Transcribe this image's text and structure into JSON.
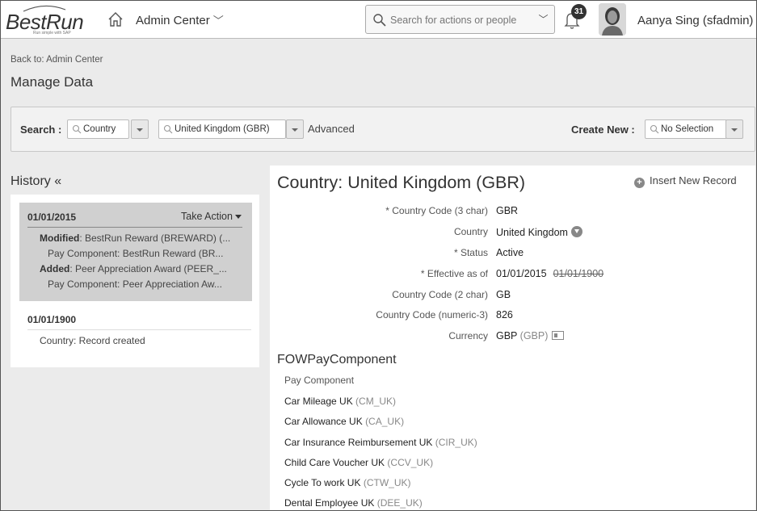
{
  "header": {
    "logo_text": "BestRun",
    "logo_tagline": "Run simple with SAP",
    "module": "Admin Center",
    "search_placeholder": "Search for actions or people",
    "notification_count": "31",
    "user": "Aanya Sing (sfadmin)"
  },
  "breadcrumb": "Back to: Admin Center",
  "page_title": "Manage Data",
  "search_bar": {
    "label": "Search :",
    "type_value": "Country",
    "record_value": "United Kingdom (GBR)",
    "advanced": "Advanced",
    "create_label": "Create New :",
    "create_value": "No Selection"
  },
  "history": {
    "title": "History «",
    "entries": [
      {
        "date": "01/01/2015",
        "action": "Take Action",
        "lines": [
          {
            "bold": "Modified",
            "text": ": BestRun Reward (BREWARD) (..."
          },
          {
            "bold": "",
            "text": "Pay Component: BestRun Reward (BR..."
          },
          {
            "bold": "Added",
            "text": ": Peer Appreciation Award (PEER_..."
          },
          {
            "bold": "",
            "text": "Pay Component: Peer Appreciation Aw..."
          }
        ]
      },
      {
        "date": "01/01/1900",
        "lines": [
          {
            "bold": "",
            "text": "Country: Record created"
          }
        ]
      }
    ]
  },
  "record": {
    "title": "Country: United Kingdom (GBR)",
    "insert_new": "Insert New Record",
    "fields": [
      {
        "label": "* Country Code (3 char)",
        "value": "GBR"
      },
      {
        "label": "Country",
        "value": "United Kingdom"
      },
      {
        "label": "* Status",
        "value": "Active"
      },
      {
        "label": "* Effective as of",
        "value": "01/01/2015",
        "old_value": "01/01/1900"
      },
      {
        "label": "Country Code (2 char)",
        "value": "GB"
      },
      {
        "label": "Country Code (numeric-3)",
        "value": "826"
      },
      {
        "label": "Currency",
        "value": "GBP",
        "sub": "(GBP)"
      }
    ],
    "section_title": "FOWPayComponent",
    "pay_head": "Pay Component",
    "pay_components": [
      {
        "name": "Car Mileage UK",
        "code": "(CM_UK)"
      },
      {
        "name": "Car Allowance UK",
        "code": "(CA_UK)"
      },
      {
        "name": "Car Insurance Reimbursement UK",
        "code": "(CIR_UK)"
      },
      {
        "name": "Child Care Voucher UK",
        "code": "(CCV_UK)"
      },
      {
        "name": "Cycle To work UK",
        "code": "(CTW_UK)"
      },
      {
        "name": "Dental Employee UK",
        "code": "(DEE_UK)"
      }
    ]
  }
}
